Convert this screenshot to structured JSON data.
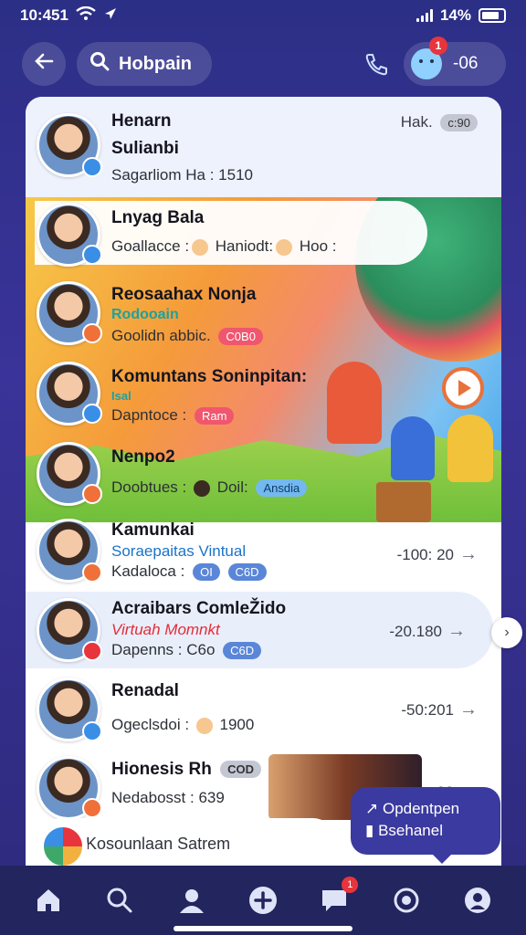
{
  "status": {
    "time": "10:451",
    "battery": "14%"
  },
  "topbar": {
    "search_label": "Hobpain",
    "counter": "-06",
    "notif_count": "1"
  },
  "rows": [
    {
      "name": "Henarn",
      "line2": "Sulianbi",
      "sub": "Sagarliom Ha : 1510",
      "meta": "Hak.",
      "meta_chip": "c:90"
    },
    {
      "name": "Lnyag Bala",
      "sub_a": "Goallacce :",
      "sub_b": "Haniodt:",
      "sub_c": "Hoo :"
    },
    {
      "name": "Reosaahax Nonja",
      "line2": "Rodooain",
      "sub": "Goolidn abbic.",
      "chip": "C0B0"
    },
    {
      "name": "Komuntans Soninpitan:",
      "line2": "Isal",
      "sub": "Dapntoce :",
      "chip": "Ram"
    },
    {
      "name": "Nenpo2",
      "sub": "Doobtues :",
      "sub_b": "Doil:",
      "chip": "Ansdia"
    },
    {
      "name": "Kamunkai",
      "line2": "Soraepaitas Vintual",
      "sub": "Kadaloca :",
      "chip_a": "OI",
      "chip_b": "C6D",
      "meta": "-100: 20"
    },
    {
      "name": "Acraibars ComleŽido",
      "line2": "Virtuah Momnkt",
      "sub": "Dapenns : C6o",
      "chip": "C6D",
      "meta": "-20.180"
    },
    {
      "name": "Renadal",
      "sub": "Ogeclsdoi :",
      "sub_b": "1900",
      "meta": "-50:201"
    },
    {
      "name": "Hionesis Rh",
      "chip_a": "COD",
      "chip_b": "I",
      "sub": "Nedabosst : 639",
      "meta": "-08"
    }
  ],
  "bottom_field": "Kosounlaan Satrem",
  "popup": {
    "line1": "Opdentpen",
    "line2": "Bsehanel"
  },
  "nav": {
    "message_badge": "1"
  },
  "colors": {
    "bg": "#2c2f86",
    "accent": "#3b3aa0",
    "red": "#e8343c"
  }
}
